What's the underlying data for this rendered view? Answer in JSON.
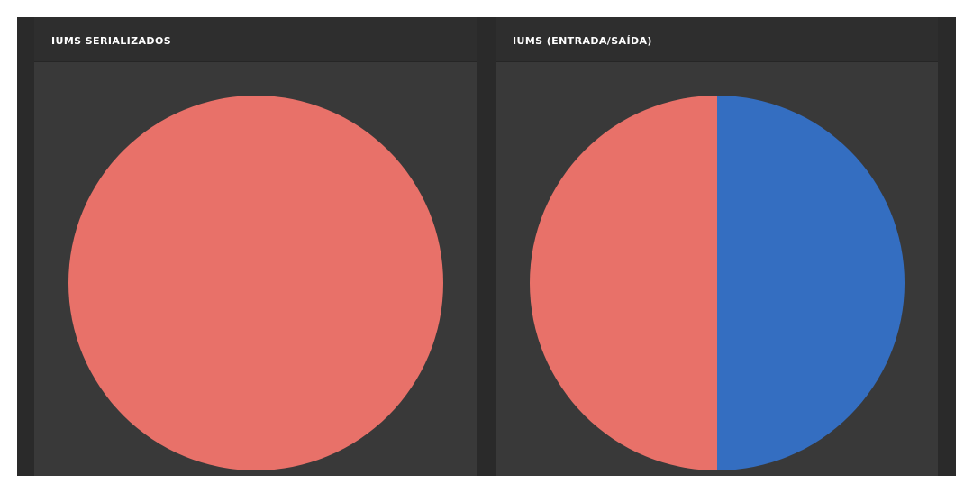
{
  "panels": [
    {
      "title": "IUMS SERIALIZADOS"
    },
    {
      "title": "IUMS (ENTRADA/SAÍDA)"
    }
  ],
  "colors": {
    "slice_red": "#e87169",
    "slice_blue": "#346ec1"
  },
  "chart_data": [
    {
      "type": "pie",
      "title": "IUMS SERIALIZADOS",
      "slices": [
        {
          "value": 100,
          "color": "#e87169"
        }
      ]
    },
    {
      "type": "pie",
      "title": "IUMS (ENTRADA/SAÍDA)",
      "slices": [
        {
          "value": 50,
          "color": "#346ec1"
        },
        {
          "value": 50,
          "color": "#e87169"
        }
      ]
    }
  ]
}
